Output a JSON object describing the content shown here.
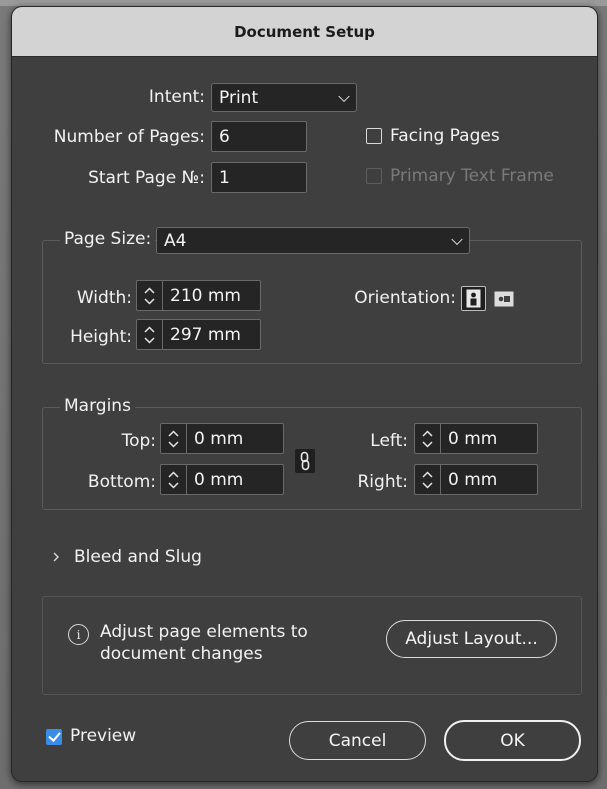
{
  "dialog": {
    "title": "Document Setup"
  },
  "intent": {
    "label": "Intent:",
    "value": "Print"
  },
  "pages": {
    "number_label": "Number of Pages:",
    "number_value": "6",
    "start_label": "Start Page №:",
    "start_value": "1",
    "facing_label": "Facing Pages",
    "facing_checked": false,
    "primary_frame_label": "Primary Text Frame",
    "primary_frame_enabled": false
  },
  "page_size": {
    "label": "Page Size:",
    "value": "A4",
    "width_label": "Width:",
    "width_value": "210 mm",
    "height_label": "Height:",
    "height_value": "297 mm",
    "orientation_label": "Orientation:",
    "orientation_selected": "portrait"
  },
  "margins": {
    "legend": "Margins",
    "top_label": "Top:",
    "top_value": "0 mm",
    "bottom_label": "Bottom:",
    "bottom_value": "0 mm",
    "left_label": "Left:",
    "left_value": "0 mm",
    "right_label": "Right:",
    "right_value": "0 mm",
    "link_icon": "chain-link-icon"
  },
  "bleed": {
    "label": "Bleed and Slug"
  },
  "adjust": {
    "line1": "Adjust page elements to",
    "line2": "document changes",
    "button": "Adjust Layout..."
  },
  "footer": {
    "preview_label": "Preview",
    "preview_checked": true,
    "cancel_label": "Cancel",
    "ok_label": "OK"
  },
  "colors": {
    "dialog_bg": "#3f3f3f",
    "titlebar_bg": "#d3d3d3",
    "field_bg": "#252525",
    "accent": "#3b8ce6"
  }
}
